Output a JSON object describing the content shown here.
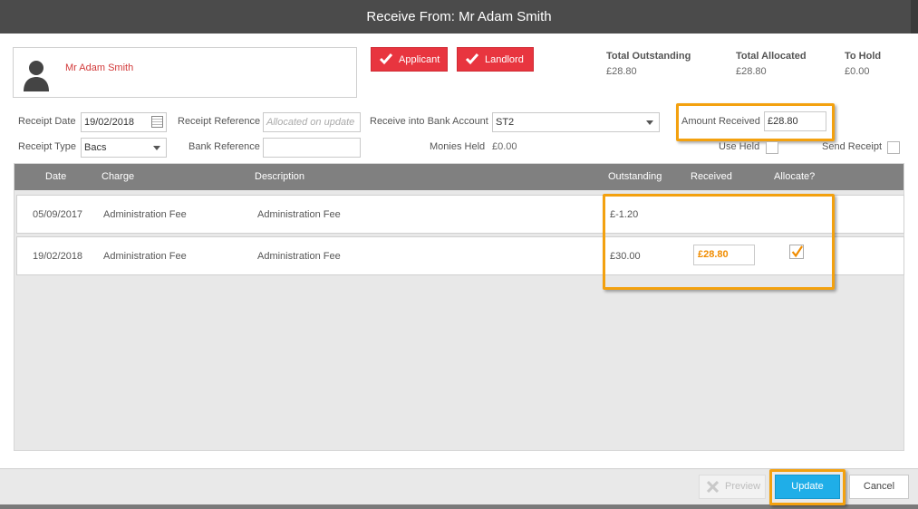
{
  "window": {
    "title": "Receive From: Mr Adam Smith"
  },
  "contact": {
    "name": "Mr Adam Smith"
  },
  "tags": [
    {
      "label": "Applicant"
    },
    {
      "label": "Landlord"
    }
  ],
  "summary": {
    "total_outstanding_label": "Total Outstanding",
    "total_outstanding_value": "£28.80",
    "total_allocated_label": "Total Allocated",
    "total_allocated_value": "£28.80",
    "to_hold_label": "To Hold",
    "to_hold_value": "£0.00"
  },
  "form": {
    "receipt_date_label": "Receipt Date",
    "receipt_date_value": "19/02/2018",
    "receipt_reference_label": "Receipt Reference",
    "receipt_reference_placeholder": "Allocated on update",
    "bank_account_label": "Receive into Bank Account",
    "bank_account_value": "ST2",
    "amount_received_label": "Amount Received",
    "amount_received_value": "£28.80",
    "receipt_type_label": "Receipt Type",
    "receipt_type_value": "Bacs",
    "bank_reference_label": "Bank Reference",
    "bank_reference_value": "",
    "monies_held_label": "Monies Held",
    "monies_held_value": "£0.00",
    "use_held_label": "Use Held",
    "send_receipt_label": "Send Receipt"
  },
  "grid": {
    "columns": {
      "date": "Date",
      "charge": "Charge",
      "description": "Description",
      "outstanding": "Outstanding",
      "received": "Received",
      "allocate": "Allocate?"
    },
    "rows": [
      {
        "date": "05/09/2017",
        "charge": "Administration Fee",
        "description": "Administration Fee",
        "outstanding": "£-1.20",
        "received": "",
        "allocated": false
      },
      {
        "date": "19/02/2018",
        "charge": "Administration Fee",
        "description": "Administration Fee",
        "outstanding": "£30.00",
        "received": "£28.80",
        "allocated": true
      }
    ]
  },
  "footer": {
    "preview_label": "Preview",
    "update_label": "Update",
    "cancel_label": "Cancel"
  },
  "colors": {
    "tag_red": "#e8353f",
    "highlight_orange": "#f3a10f",
    "update_blue": "#1faee8",
    "header_gray": "#808080"
  }
}
